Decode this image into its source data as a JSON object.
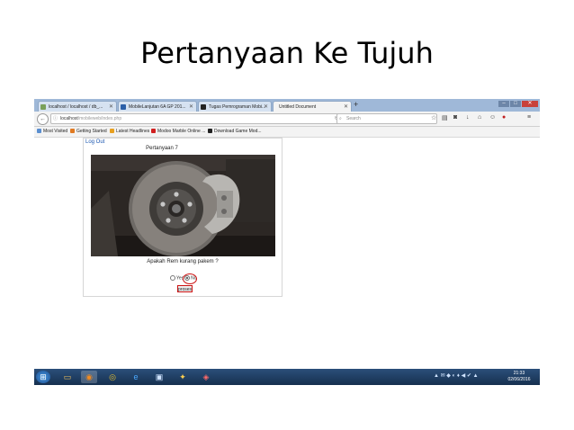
{
  "slide": {
    "title": "Pertanyaan Ke Tujuh"
  },
  "browser": {
    "tabs": [
      {
        "label": "localhost / localhost / db_...",
        "favicon_color": "#7aa05a",
        "active": false
      },
      {
        "label": "MobileLanjutan 6A GP 201...",
        "favicon_color": "#2b5fa8",
        "active": false
      },
      {
        "label": "Tugas Pemrograman Mobi...",
        "favicon_color": "#222222",
        "active": false
      },
      {
        "label": "Untitled Document",
        "favicon_color": "#f3f3f3",
        "active": true
      }
    ],
    "new_tab_symbol": "+",
    "window_controls": [
      "–",
      "□",
      "✕"
    ],
    "address": {
      "host": "localhost",
      "path": "/mobileweb/index.php"
    },
    "search_placeholder": "Search",
    "bookmarks": [
      {
        "label": "Most Visited",
        "color": "#5b8fd0"
      },
      {
        "label": "Getting Started",
        "color": "#e07a22"
      },
      {
        "label": "Latest Headlines",
        "color": "#e8a020"
      },
      {
        "label": "Modoo Marble Online ...",
        "color": "#d02020"
      },
      {
        "label": "Download Game Mod...",
        "color": "#222222"
      }
    ]
  },
  "page": {
    "logout": "Log Out",
    "question_heading": "Pertanyaan 7",
    "question": "Apakah Rem kurang pakem ?",
    "options": [
      {
        "label": "Yes",
        "selected": false
      },
      {
        "label": "No",
        "selected": true
      }
    ],
    "submit_label": "proses",
    "highlight_color": "#cc1111"
  },
  "taskbar": {
    "clock_time": "21:33",
    "clock_date": "02/06/2016"
  }
}
